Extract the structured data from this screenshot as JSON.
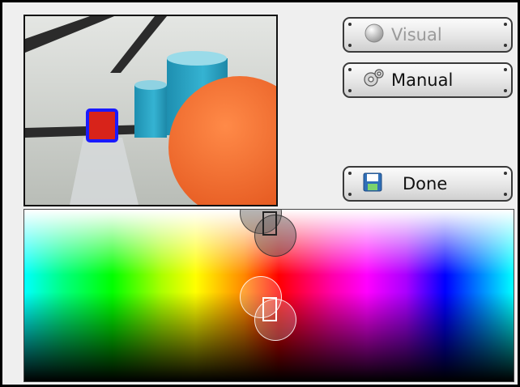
{
  "buttons": {
    "visual": {
      "label": "Visual",
      "icon": "radio-sphere-icon",
      "enabled": false
    },
    "manual": {
      "label": "Manual",
      "icon": "gear-icon",
      "enabled": true
    },
    "done": {
      "label": "Done",
      "icon": "floppy-disk-icon",
      "enabled": true
    }
  },
  "colors": {
    "selection_box": "#1a1aff",
    "ball": "#f26a2a",
    "cylinder": "#2aa6c6"
  }
}
